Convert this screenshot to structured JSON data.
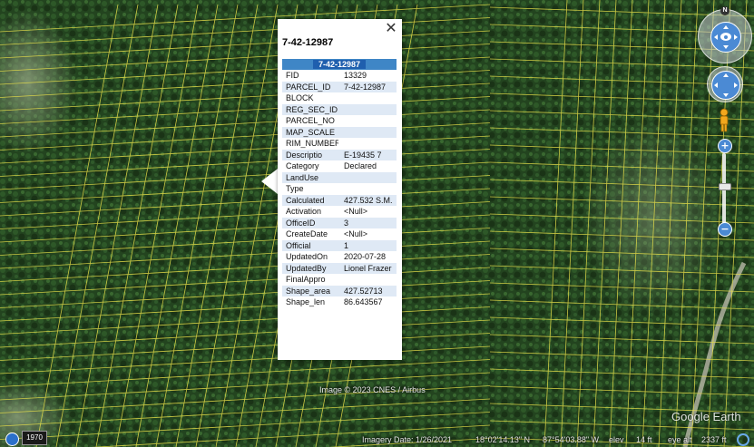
{
  "popup": {
    "title": "7-42-12987",
    "table_header": "7-42-12987",
    "rows": [
      {
        "label": "FID",
        "value": "13329"
      },
      {
        "label": "PARCEL_ID",
        "value": "7-42-12987"
      },
      {
        "label": "BLOCK",
        "value": ""
      },
      {
        "label": "REG_SEC_ID",
        "value": ""
      },
      {
        "label": "PARCEL_NO",
        "value": ""
      },
      {
        "label": "MAP_SCALE",
        "value": ""
      },
      {
        "label": "RIM_NUMBER",
        "value": ""
      },
      {
        "label": "Descriptio",
        "value": "E-19435 7"
      },
      {
        "label": "Category",
        "value": "Declared"
      },
      {
        "label": "LandUse",
        "value": ""
      },
      {
        "label": "Type",
        "value": ""
      },
      {
        "label": "Calculated",
        "value": "427.532 S.M."
      },
      {
        "label": "Activation",
        "value": "<Null>"
      },
      {
        "label": "OfficeID",
        "value": "3"
      },
      {
        "label": "CreateDate",
        "value": "<Null>"
      },
      {
        "label": "Official",
        "value": "1"
      },
      {
        "label": "UpdatedOn",
        "value": "2020-07-28"
      },
      {
        "label": "UpdatedBy",
        "value": "Lionel Frazer"
      },
      {
        "label": "FinalAppro",
        "value": ""
      },
      {
        "label": "Shape_area",
        "value": "427.52713"
      },
      {
        "label": "Shape_len",
        "value": "86.643567"
      }
    ],
    "close_icon": "close-icon"
  },
  "map": {
    "copyright": "Image © 2023 CNES / Airbus",
    "logo": "Google Earth",
    "compass_letter": "N"
  },
  "status": {
    "imagery_date": "Imagery Date: 1/26/2021",
    "latitude": "18°02'14.13\" N",
    "longitude": "87°54'03.88\" W",
    "elev_label": "elev",
    "elev_value": "14 ft",
    "eye_alt_label": "eye alt",
    "eye_alt_value": "2337 ft"
  },
  "timeline": {
    "year": "1970"
  },
  "colors": {
    "parcel_lines": "#e8e04a",
    "header_blue": "#3f86c6",
    "row_shade": "#dfe9f5"
  }
}
